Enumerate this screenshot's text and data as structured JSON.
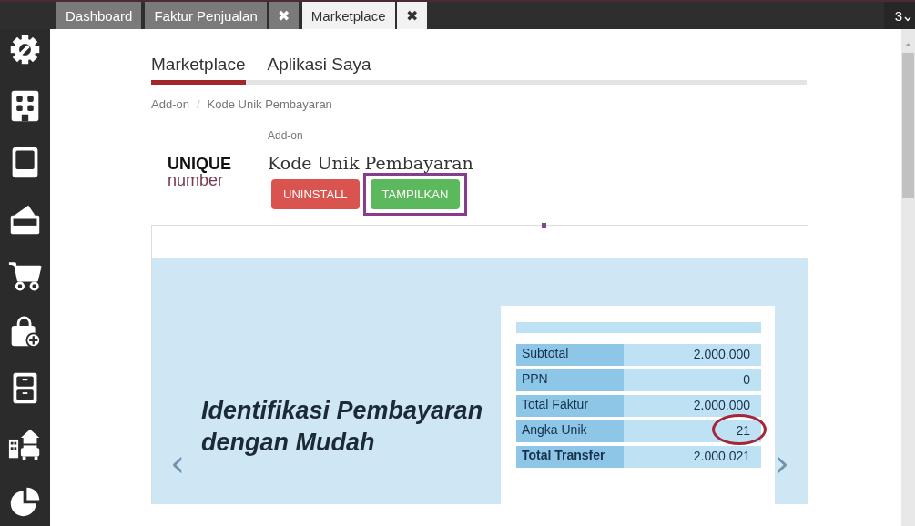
{
  "top_tabs": [
    {
      "label": "Dashboard",
      "selected": false,
      "closable": false
    },
    {
      "label": "Faktur Penjualan",
      "selected": false,
      "closable": true,
      "close_glyph": "✖"
    },
    {
      "label": "Marketplace",
      "selected": true,
      "closable": true,
      "close_glyph": "✖"
    }
  ],
  "tab_counter": "3",
  "sidebar": {
    "items": [
      {
        "kind": "gear"
      },
      {
        "kind": "building"
      },
      {
        "kind": "book"
      },
      {
        "kind": "wallet"
      },
      {
        "kind": "cart"
      },
      {
        "kind": "bag"
      },
      {
        "kind": "cabinet"
      },
      {
        "kind": "assets"
      },
      {
        "kind": "pie"
      }
    ]
  },
  "nav_tabs": [
    {
      "label": "Marketplace",
      "selected": true
    },
    {
      "label": "Aplikasi Saya",
      "selected": false
    }
  ],
  "breadcrumb": {
    "items": [
      "Add-on",
      "Kode Unik Pembayaran"
    ],
    "separator": "/"
  },
  "addon": {
    "logo_line_1": "UNIQUE",
    "logo_line_2": "number",
    "category": "Add-on",
    "title": "Kode Unik Pembayaran",
    "buttons": [
      {
        "label": "UNINSTALL",
        "kind": "danger",
        "highlighted": false
      },
      {
        "label": "TAMPILKAN",
        "kind": "success",
        "highlighted": true
      }
    ]
  },
  "slide": {
    "headline": "Identifikasi Pembayaran dengan Mudah",
    "prev": "‹",
    "next": "›",
    "rows": [
      {
        "label": "Subtotal",
        "value": "2.000.000",
        "bold": false,
        "circled": false
      },
      {
        "label": "PPN",
        "value": "0",
        "bold": false,
        "circled": false
      },
      {
        "label": "Total Faktur",
        "value": "2.000.000",
        "bold": false,
        "circled": false
      },
      {
        "label": "Angka Unik",
        "value": "21",
        "bold": false,
        "circled": true
      },
      {
        "label": "Total Transfer",
        "value": "2.000.021",
        "bold": true,
        "circled": false
      }
    ]
  }
}
